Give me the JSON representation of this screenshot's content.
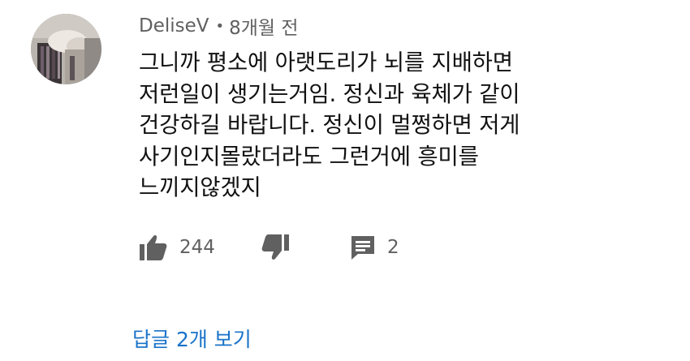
{
  "comment": {
    "author": "DeliseV",
    "separator": "•",
    "time": "8개월 전",
    "lines": [
      "그니까 평소에 아랫도리가 뇌를 지배하면",
      "저런일이 생기는거임. 정신과 육체가 같이",
      "건강하길 바랍니다. 정신이 멀쩡하면 저게",
      "사기인지몰랐더라도 그런거에 흥미를",
      "느끼지않겠지"
    ],
    "actions": {
      "like_icon": "thumbs-up-icon",
      "like_count": "244",
      "dislike_icon": "thumbs-down-icon",
      "reply_icon": "comment-icon",
      "reply_count": "2"
    },
    "view_replies": "답글 2개 보기"
  },
  "colors": {
    "meta_text": "#606060",
    "body_text": "#111111",
    "link": "#1a73c9",
    "icon": "#606060"
  }
}
